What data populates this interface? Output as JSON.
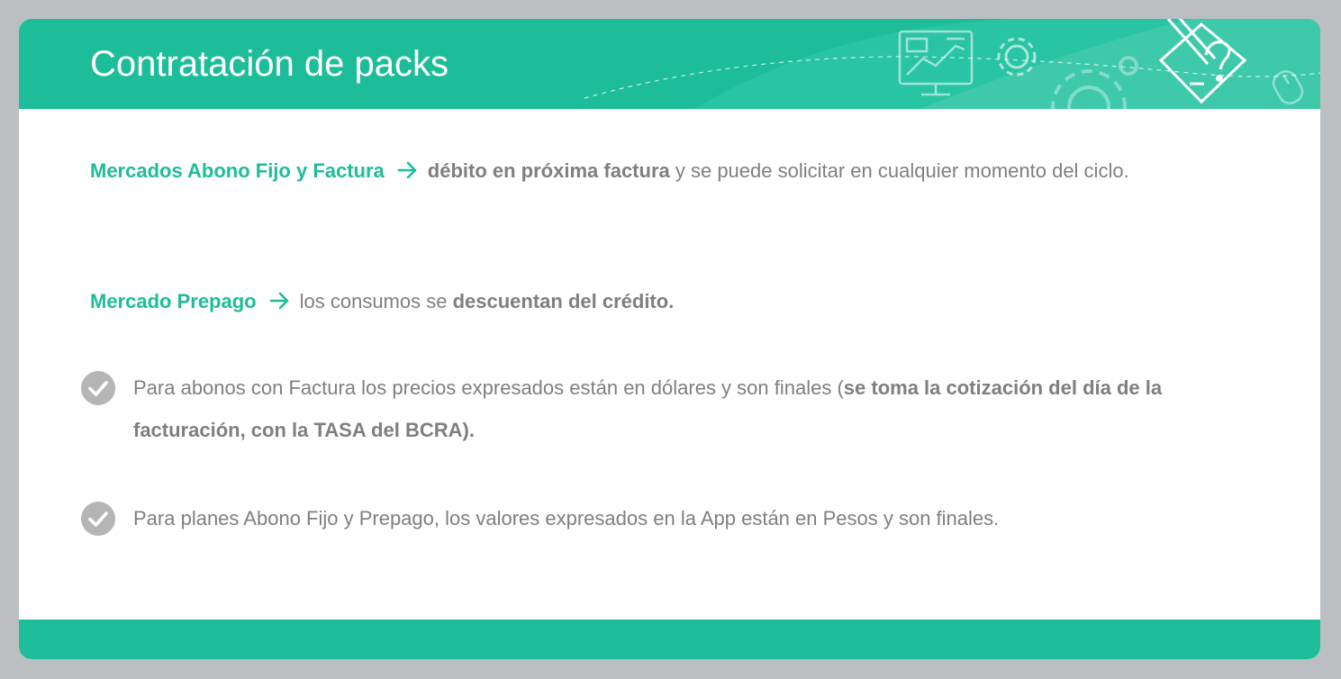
{
  "slide": {
    "title": "Contratación de packs"
  },
  "paragraphs": [
    {
      "label": "Mercados Abono Fijo y Factura",
      "bold_text": "débito en próxima factura",
      "rest_text": " y se puede solicitar en cualquier momento del ciclo."
    },
    {
      "label": "Mercado Prepago",
      "pre_text": "los consumos se ",
      "bold_text": "descuentan del crédito."
    }
  ],
  "bullets": [
    {
      "text": "Para abonos con Factura los precios expresados están en dólares y son finales (",
      "bold_text": "se toma la cotización del día de la facturación, con la TASA del BCRA)."
    },
    {
      "text": "Para planes Abono Fijo y Prepago, los valores expresados en la App están en Pesos y son finales."
    }
  ],
  "colors": {
    "accent": "#1dbd9a",
    "text": "#7f7f7f",
    "check_circle": "#b5b5b5",
    "background": "#bbbfc2"
  },
  "icons": {
    "header": [
      "monitor-chart-icon",
      "gear-icon",
      "large-gear-icon",
      "pencil-question-icon",
      "mouse-icon"
    ],
    "arrow": "arrow-right-icon",
    "bullet": "check-circle-icon"
  }
}
